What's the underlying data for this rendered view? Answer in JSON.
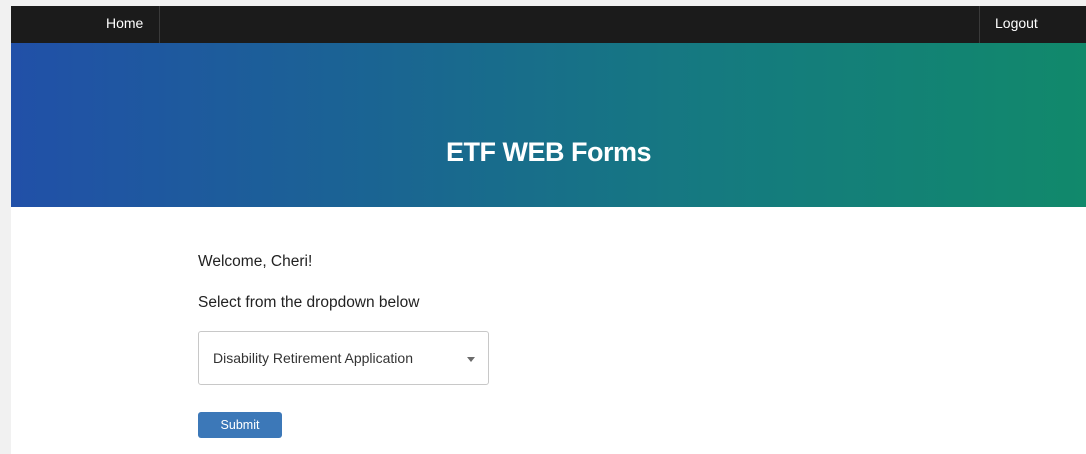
{
  "nav": {
    "home_label": "Home",
    "logout_label": "Logout"
  },
  "hero": {
    "title": "ETF WEB Forms"
  },
  "main": {
    "welcome_text": "Welcome, Cheri!",
    "instruction_text": "Select from the dropdown below",
    "form_select": {
      "selected_value": "Disability Retirement Application"
    },
    "submit_label": "Submit"
  },
  "colors": {
    "navbar_bg": "#1b1b1b",
    "hero_gradient_start": "#2150a8",
    "hero_gradient_end": "#11896b",
    "button_bg": "#3c78b8"
  },
  "icons": {
    "dropdown": "caret-down-icon"
  }
}
